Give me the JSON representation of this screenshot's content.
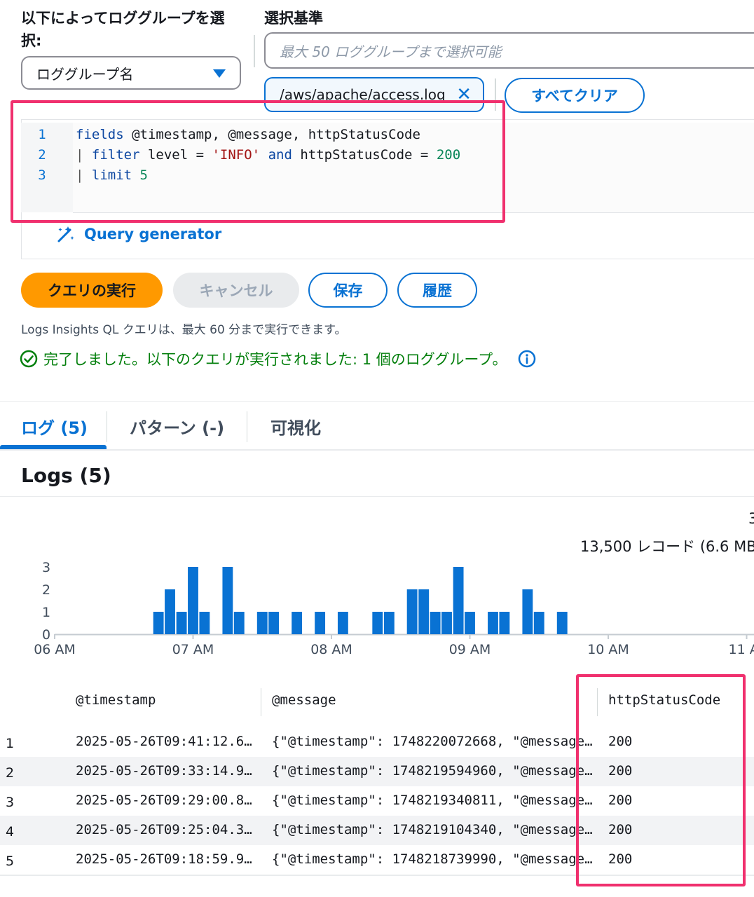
{
  "selector": {
    "label": "以下によってロググループを選択:",
    "dropdown_value": "ロググループ名"
  },
  "criteria": {
    "label": "選択基準",
    "input_placeholder": "最大 50 ロググループまで選択可能",
    "token_value": "/aws/apache/access.log",
    "clear_all": "すべてクリア"
  },
  "editor": {
    "line_numbers": [
      "1",
      "2",
      "3"
    ],
    "lines": [
      [
        [
          "kw",
          "fields "
        ],
        [
          "plain",
          "@timestamp, @message, httpStatusCode"
        ]
      ],
      [
        [
          "pipe",
          "| "
        ],
        [
          "kw",
          "filter "
        ],
        [
          "plain",
          "level = "
        ],
        [
          "str",
          "'INFO'"
        ],
        [
          "plain",
          " "
        ],
        [
          "kw",
          "and "
        ],
        [
          "plain",
          "httpStatusCode = "
        ],
        [
          "num",
          "200"
        ]
      ],
      [
        [
          "pipe",
          "| "
        ],
        [
          "kw",
          "limit "
        ],
        [
          "num",
          "5"
        ]
      ]
    ]
  },
  "query_generator": "Query generator",
  "buttons": {
    "run": "クエリの実行",
    "cancel": "キャンセル",
    "save": "保存",
    "history": "履歴"
  },
  "info_text": "Logs Insights QL クエリは、最大 60 分まで実行できます。",
  "status_text": "完了しました。以下のクエリが実行されました: 1 個のロググループ。",
  "colors": {
    "accent": "#0972d3",
    "primary": "#ff9900",
    "success": "#037f0c",
    "highlight": "#f0306e",
    "bar": "#0972d3"
  },
  "tabs": [
    {
      "label": "ログ (5)",
      "active": true
    },
    {
      "label": "パターン (-)",
      "active": false
    },
    {
      "label": "可視化",
      "active": false
    }
  ],
  "logs_heading": "Logs (5)",
  "records_text": "13,500 レコード (6.6 MB",
  "chart_data": {
    "type": "bar",
    "ylim": [
      0,
      3
    ],
    "y_ticks": [
      "3",
      "2",
      "1",
      "0"
    ],
    "x_ticks": [
      {
        "label": "06 AM",
        "x": 6.0
      },
      {
        "label": "07 AM",
        "x": 7.0
      },
      {
        "label": "08 AM",
        "x": 8.0
      },
      {
        "label": "09 AM",
        "x": 9.0
      },
      {
        "label": "10 AM",
        "x": 10.0
      },
      {
        "label": "11 A",
        "x": 11.0
      }
    ],
    "bin_hours": 0.0833,
    "bins": [
      {
        "x": 6.75,
        "y": 1
      },
      {
        "x": 6.833,
        "y": 2
      },
      {
        "x": 6.917,
        "y": 1
      },
      {
        "x": 7.0,
        "y": 3
      },
      {
        "x": 7.083,
        "y": 1
      },
      {
        "x": 7.25,
        "y": 3
      },
      {
        "x": 7.333,
        "y": 1
      },
      {
        "x": 7.5,
        "y": 1
      },
      {
        "x": 7.583,
        "y": 1
      },
      {
        "x": 7.75,
        "y": 1
      },
      {
        "x": 7.917,
        "y": 1
      },
      {
        "x": 8.083,
        "y": 1
      },
      {
        "x": 8.333,
        "y": 1
      },
      {
        "x": 8.417,
        "y": 1
      },
      {
        "x": 8.583,
        "y": 2
      },
      {
        "x": 8.667,
        "y": 2
      },
      {
        "x": 8.75,
        "y": 1
      },
      {
        "x": 8.833,
        "y": 1
      },
      {
        "x": 8.917,
        "y": 3
      },
      {
        "x": 9.0,
        "y": 1
      },
      {
        "x": 9.167,
        "y": 1
      },
      {
        "x": 9.25,
        "y": 1
      },
      {
        "x": 9.417,
        "y": 2
      },
      {
        "x": 9.5,
        "y": 1
      },
      {
        "x": 9.667,
        "y": 1
      }
    ]
  },
  "table": {
    "columns": [
      "@timestamp",
      "@message",
      "httpStatusCode"
    ],
    "rows": [
      {
        "n": "1",
        "timestamp": "2025-05-26T09:41:12.6…",
        "message": "{\"@timestamp\": 1748220072668, \"@message…",
        "code": "200"
      },
      {
        "n": "2",
        "timestamp": "2025-05-26T09:33:14.9…",
        "message": "{\"@timestamp\": 1748219594960, \"@message…",
        "code": "200"
      },
      {
        "n": "3",
        "timestamp": "2025-05-26T09:29:00.8…",
        "message": "{\"@timestamp\": 1748219340811, \"@message…",
        "code": "200"
      },
      {
        "n": "4",
        "timestamp": "2025-05-26T09:25:04.3…",
        "message": "{\"@timestamp\": 1748219104340, \"@message…",
        "code": "200"
      },
      {
        "n": "5",
        "timestamp": "2025-05-26T09:18:59.9…",
        "message": "{\"@timestamp\": 1748218739990, \"@message…",
        "code": "200"
      }
    ]
  }
}
